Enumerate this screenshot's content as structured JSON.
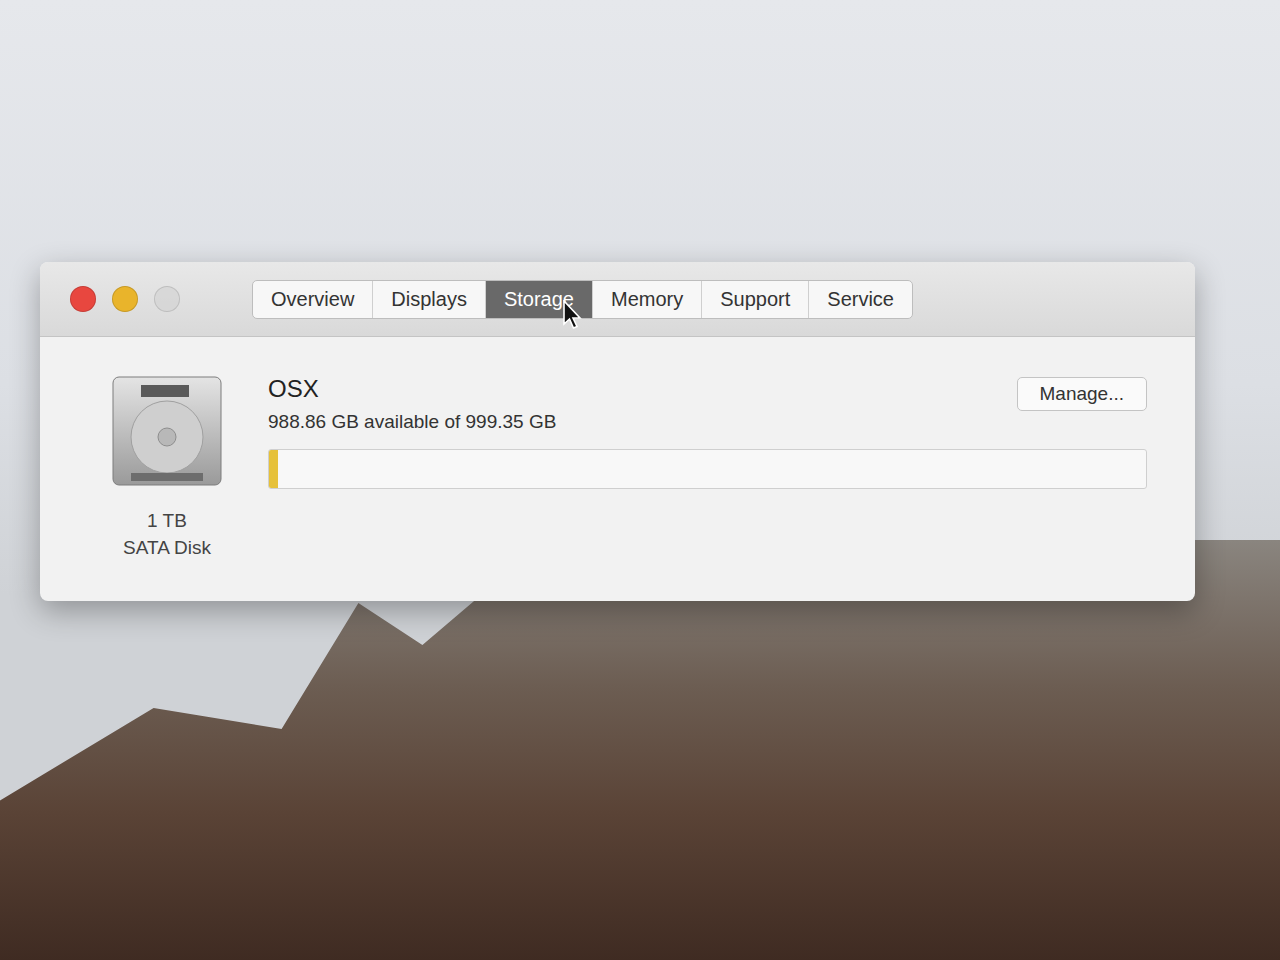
{
  "window": {
    "controls": [
      {
        "name": "close",
        "color": "#e8473f",
        "disabled": false
      },
      {
        "name": "minimize",
        "color": "#e9b42b",
        "disabled": false
      },
      {
        "name": "zoom",
        "color": "#d6d6d6",
        "disabled": true
      }
    ]
  },
  "tabs": [
    {
      "label": "Overview",
      "selected": false
    },
    {
      "label": "Displays",
      "selected": false
    },
    {
      "label": "Storage",
      "selected": true
    },
    {
      "label": "Memory",
      "selected": false
    },
    {
      "label": "Support",
      "selected": false
    },
    {
      "label": "Service",
      "selected": false
    }
  ],
  "disk": {
    "capacity": "1 TB",
    "type": "SATA Disk",
    "name": "OSX",
    "summary": "988.86 GB available of 999.35 GB",
    "level": 0.0105
  },
  "buttons": [
    "Manage..."
  ]
}
